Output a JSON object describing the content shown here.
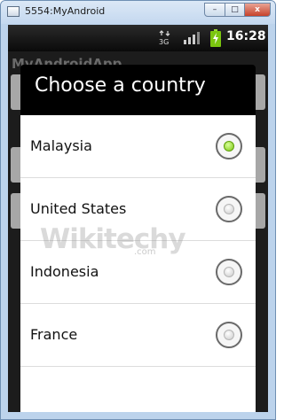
{
  "window": {
    "title": "5554:MyAndroid",
    "controls": {
      "minimize": "–",
      "maximize": "□",
      "close": "x"
    }
  },
  "status_bar": {
    "icons": [
      "3g-data-icon",
      "signal-bars-icon",
      "battery-charging-icon"
    ],
    "time": "16:28"
  },
  "app": {
    "title": "MyAndroidApp"
  },
  "dialog": {
    "title": "Choose a country",
    "options": [
      {
        "label": "Malaysia",
        "selected": true
      },
      {
        "label": "United States",
        "selected": false
      },
      {
        "label": "Indonesia",
        "selected": false
      },
      {
        "label": "France",
        "selected": false
      }
    ]
  },
  "colors": {
    "radio_selected": "#7bc60f",
    "dialog_title_bg": "#000000",
    "list_bg": "#ffffff"
  },
  "watermark": {
    "logo": "Wikitechy",
    "domain": ".com"
  }
}
